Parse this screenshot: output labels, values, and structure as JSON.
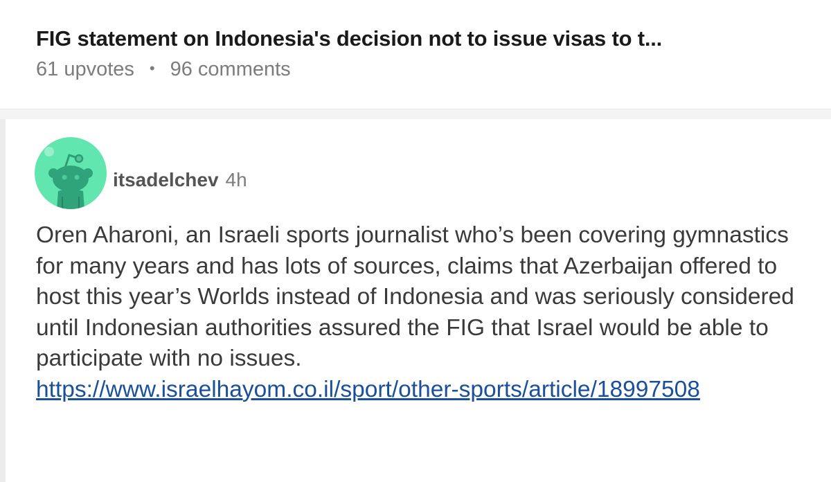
{
  "post": {
    "title": "FIG statement on Indonesia's decision not to issue visas to t...",
    "upvotes": "61 upvotes",
    "separator": "•",
    "comments": "96 comments"
  },
  "comment": {
    "avatar_icon": "reddit-snoo-avatar-icon",
    "avatar_color": "#62e6b0",
    "username": "itsadelchev",
    "timestamp": "4h",
    "body": "Oren Aharoni, an Israeli sports journalist who’s been covering gymnastics for many years and has lots of sources, claims that Azerbaijan offered to host this year’s Worlds instead of Indonesia and was seriously considered until Indonesian authorities assured the FIG that Israel would be able to participate with no issues.",
    "link": "https://www.israelhayom.co.il/sport/other-sports/article/18997508"
  },
  "colors": {
    "link": "#1a4f9a",
    "meta_text": "#7c7c7c",
    "divider": "#f4f4f4"
  }
}
